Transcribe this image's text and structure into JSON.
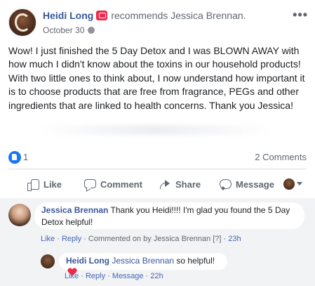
{
  "post": {
    "author": "Heidi Long",
    "recommends_text": "recommends",
    "target": "Jessica Brennan.",
    "date": "October 30",
    "more_label": "•••",
    "text": "Wow! I just finished the 5 Day Detox and I was BLOWN AWAY with how much I didn't know about the toxins in our household products! With two little ones to think about, I now understand how important it is to choose products that are free from fragrance, PEGs and other ingredients that are linked to health concerns. Thank you Jessica!",
    "like_count": "1",
    "comments_count": "2 Comments"
  },
  "actions": {
    "like": "Like",
    "comment": "Comment",
    "share": "Share",
    "message": "Message"
  },
  "comments": [
    {
      "author": "Jessica Brennan",
      "text": "Thank you Heidi!!!! I'm glad you found the 5 Day Detox helpful!",
      "like": "Like",
      "reply": "Reply",
      "sep": "·",
      "commented_on_by": "Commented on by Jessica Brennan",
      "marker": "[?]",
      "time": "23h"
    },
    {
      "author": "Heidi Long",
      "mention": "Jessica Brennan",
      "text": "so helpful!",
      "like": "Like",
      "reply": "Reply",
      "message": "Message",
      "sep": "·",
      "time": "22h"
    }
  ],
  "colors": {
    "link": "#385898",
    "accent": "#1877f2",
    "heart": "#f0284a",
    "badge": "#f02849"
  }
}
